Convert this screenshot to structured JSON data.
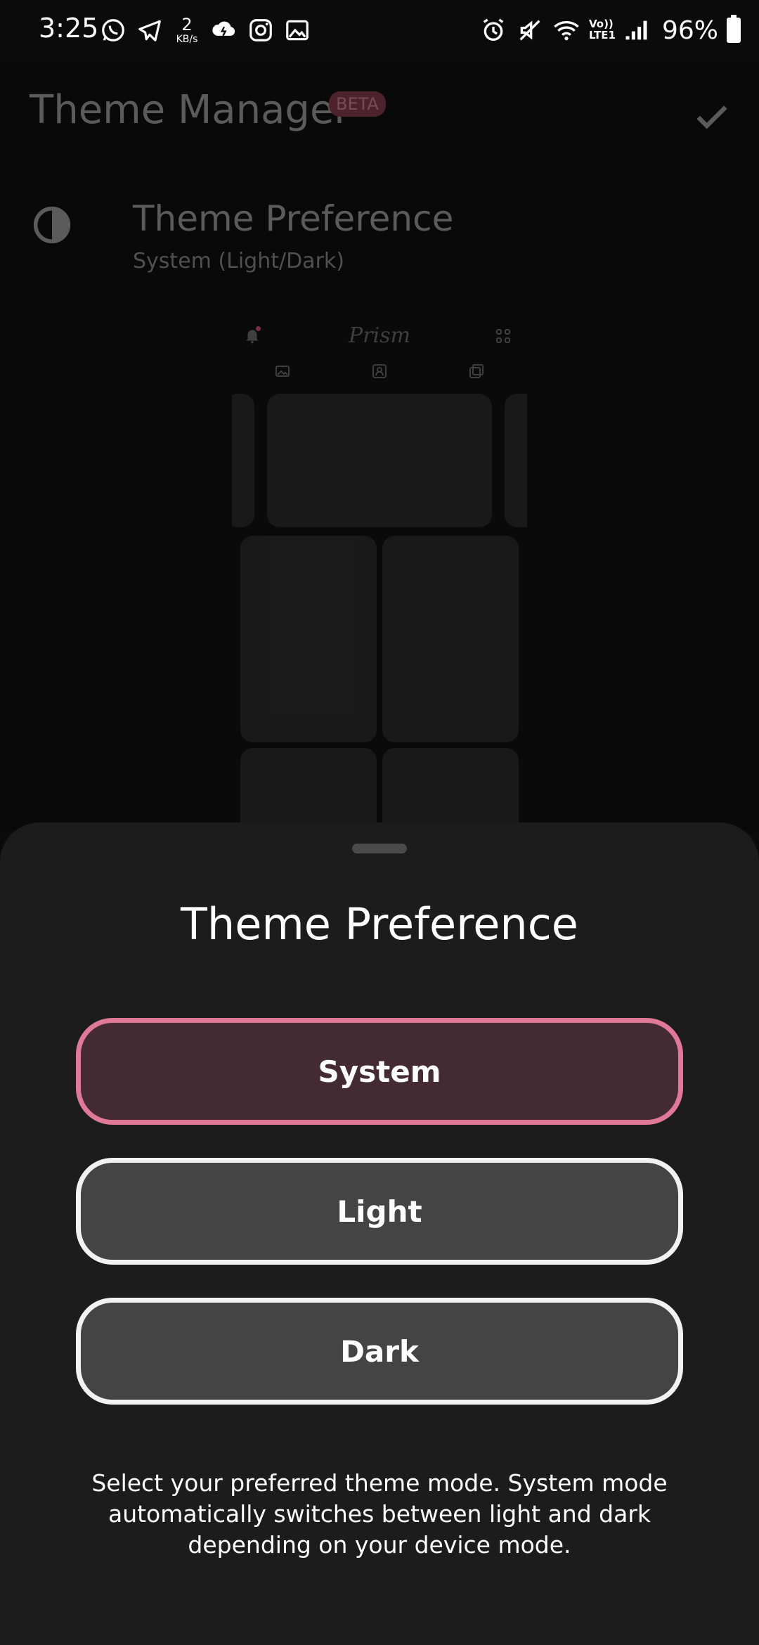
{
  "status_bar": {
    "time": "3:25",
    "net_speed_value": "2",
    "net_speed_unit": "KB/s",
    "lte_top": "Vo))",
    "lte_bottom": "LTE1",
    "battery": "96%"
  },
  "header": {
    "title": "Theme Manager",
    "badge": "BETA"
  },
  "preference_row": {
    "title": "Theme Preference",
    "subtitle": "System (Light/Dark)"
  },
  "preview": {
    "logo": "Prism"
  },
  "sheet": {
    "title": "Theme Preference",
    "options": [
      {
        "label": "System",
        "selected": true
      },
      {
        "label": "Light",
        "selected": false
      },
      {
        "label": "Dark",
        "selected": false
      }
    ],
    "description": "Select your preferred theme mode. System mode automatically switches between light and dark depending on your device mode."
  },
  "colors": {
    "accent": "#e07898",
    "selected_fill": "#432a33",
    "option_fill": "#444444",
    "sheet_bg": "#1c1c1c"
  }
}
